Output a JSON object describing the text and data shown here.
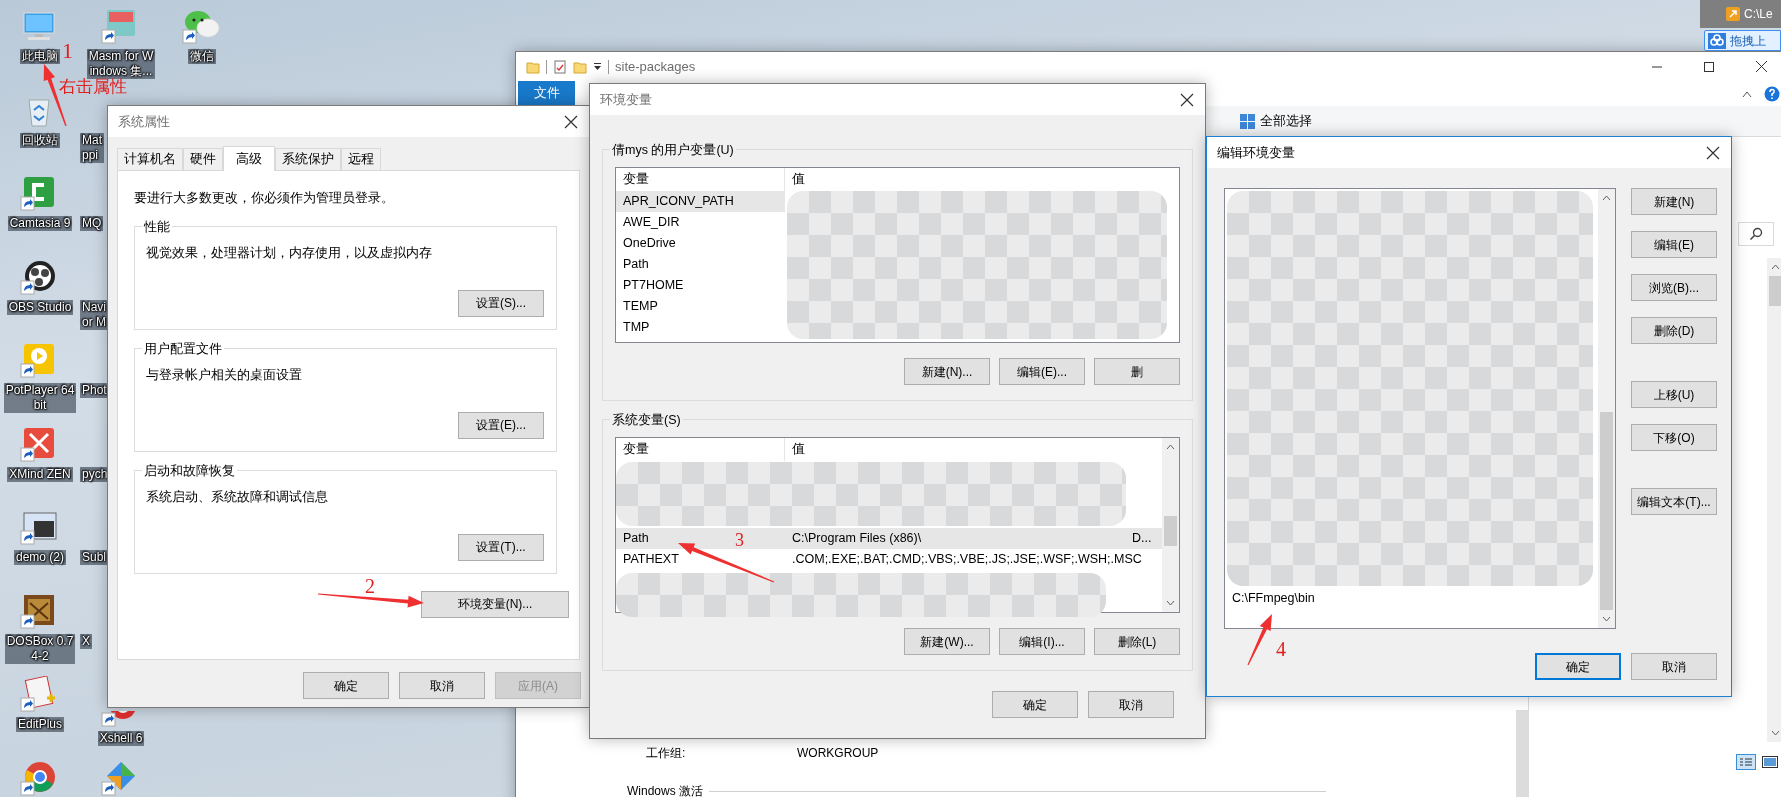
{
  "desktop": {
    "columns": [
      [
        {
          "label": "此电脑",
          "kind": "computer"
        },
        {
          "label": "回收站",
          "kind": "recycle"
        },
        {
          "label": "Camtasia 9",
          "kind": "camtasia"
        },
        {
          "label": "OBS Studio",
          "kind": "obs"
        },
        {
          "label": "PotPlayer 64\nbit",
          "kind": "potplayer"
        },
        {
          "label": "XMind ZEN",
          "kind": "xmind"
        },
        {
          "label": "demo (2)",
          "kind": "demo"
        },
        {
          "label": "DOSBox 0.7\n4-2",
          "kind": "dosbox"
        },
        {
          "label": "EditPlus",
          "kind": "editplus"
        },
        {
          "kind": "chrome"
        }
      ],
      [
        {
          "label": "Masm for W\nindows 集...",
          "kind": "masm"
        },
        {
          "label": "Mat\nppi",
          "kind": "covered"
        },
        {
          "label": "MQ",
          "kind": "covered"
        },
        {
          "label": "Navi\nor M",
          "kind": "covered"
        },
        {
          "label": "Phot",
          "kind": "covered"
        },
        {
          "label": "pych",
          "kind": "covered"
        },
        {
          "label": "Subl",
          "kind": "covered"
        },
        {
          "label": "X",
          "kind": "covered"
        },
        {
          "label": "Xshell 6",
          "kind": "xshell"
        },
        {
          "kind": "app"
        }
      ],
      [
        {
          "label": "微信",
          "kind": "wechat"
        }
      ]
    ]
  },
  "tray": {
    "path_text": "C:\\Le",
    "upload_button": "拖拽上"
  },
  "explorer": {
    "title": "site-packages",
    "ribbon_tab": "文件",
    "select_all": "全部选择",
    "workgroup_label": "工作组:",
    "workgroup_value": "WORKGROUP",
    "activation_heading": "Windows 激活"
  },
  "system_properties": {
    "title": "系统属性",
    "tabs": [
      {
        "label": "计算机名",
        "selected": false
      },
      {
        "label": "硬件",
        "selected": false
      },
      {
        "label": "高级",
        "selected": true
      },
      {
        "label": "系统保护",
        "selected": false
      },
      {
        "label": "远程",
        "selected": false
      }
    ],
    "notice": "要进行大多数更改，你必须作为管理员登录。",
    "groups": [
      {
        "title": "性能",
        "description": "视觉效果，处理器计划，内存使用，以及虚拟内存",
        "button": "设置(S)..."
      },
      {
        "title": "用户配置文件",
        "description": "与登录帐户相关的桌面设置",
        "button": "设置(E)..."
      },
      {
        "title": "启动和故障恢复",
        "description": "系统启动、系统故障和调试信息",
        "button": "设置(T)..."
      }
    ],
    "env_button": "环境变量(N)...",
    "footer_buttons": [
      {
        "label": "确定",
        "disabled": false
      },
      {
        "label": "取消",
        "disabled": false
      },
      {
        "label": "应用(A)",
        "disabled": true
      }
    ]
  },
  "environment_variables": {
    "title": "环境变量",
    "user_group": {
      "title": "倩mys 的用户变量(U)",
      "columns": [
        "变量",
        "值"
      ],
      "rows": [
        {
          "name": "APR_ICONV_PATH",
          "selected": true
        },
        {
          "name": "AWE_DIR",
          "selected": false
        },
        {
          "name": "OneDrive",
          "selected": false
        },
        {
          "name": "Path",
          "selected": false
        },
        {
          "name": "PT7HOME",
          "selected": false
        },
        {
          "name": "TEMP",
          "selected": false
        },
        {
          "name": "TMP",
          "selected": false
        }
      ],
      "buttons": [
        "新建(N)...",
        "编辑(E)...",
        "删"
      ]
    },
    "system_group": {
      "title": "系统变量(S)",
      "columns": [
        "变量",
        "值"
      ],
      "rows": [
        {
          "name": "Path",
          "value": "C:\\Program Files (x86)\\",
          "value_tail": "D...",
          "selected": true
        },
        {
          "name": "PATHEXT",
          "value": ".COM;.EXE;.BAT;.CMD;.VBS;.VBE;.JS;.JSE;.WSF;.WSH;.MSC",
          "selected": false
        }
      ],
      "buttons": [
        "新建(W)...",
        "编辑(I)...",
        "删除(L)"
      ]
    },
    "footer_buttons": [
      "确定",
      "取消"
    ]
  },
  "edit_variable": {
    "title": "编辑环境变量",
    "entries": [
      {
        "text": "C:\\FFmpeg\\bin",
        "selected": false
      }
    ],
    "side_buttons": [
      "新建(N)",
      "编辑(E)",
      "浏览(B)...",
      "删除(D)",
      "上移(U)",
      "下移(O)",
      "编辑文本(T)..."
    ],
    "footer_buttons": [
      {
        "label": "确定",
        "focused": true
      },
      {
        "label": "取消",
        "focused": false
      }
    ]
  },
  "annotations": [
    {
      "text": "1"
    },
    {
      "text": "右击属性"
    },
    {
      "text": "2"
    },
    {
      "text": "3"
    },
    {
      "text": "4"
    }
  ]
}
